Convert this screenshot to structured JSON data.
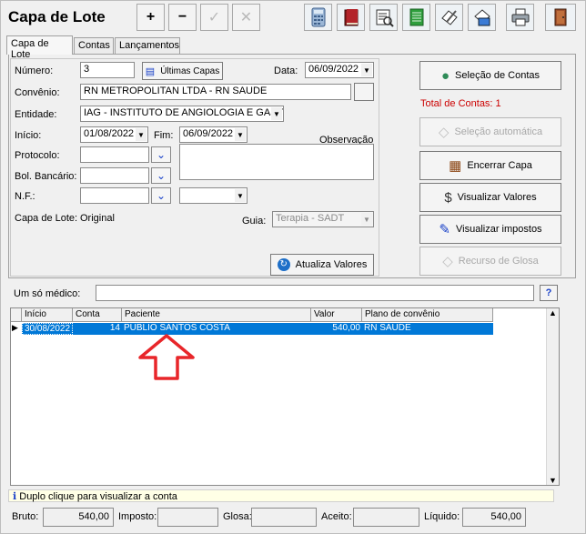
{
  "window": {
    "title": "Capa de Lote"
  },
  "toolbar": {
    "add_label": "+",
    "remove_label": "−",
    "confirm_label": "✓",
    "cancel_label": "✕",
    "icons": [
      "calculator-icon",
      "book-icon",
      "print-preview-icon",
      "spreadsheet-icon",
      "document-edit-icon",
      "money-card-icon",
      "printer-icon",
      "exit-door-icon"
    ]
  },
  "tabs": [
    "Capa de Lote",
    "Contas",
    "Lançamentos"
  ],
  "form": {
    "numero_label": "Número:",
    "numero_value": "3",
    "ultimas_capas_label": "Últimas Capas",
    "data_label": "Data:",
    "data_value": "06/09/2022",
    "convenio_label": "Convênio:",
    "convenio_value": "RN METROPOLITAN LTDA - RN SAUDE",
    "entidade_label": "Entidade:",
    "entidade_value": "IAG - INSTITUTO DE ANGIOLOGIA E GASTI",
    "inicio_label": "Início:",
    "inicio_value": "01/08/2022",
    "fim_label": "Fim:",
    "fim_value": "06/09/2022",
    "observacao_label": "Observação",
    "protocolo_label": "Protocolo:",
    "bol_bancario_label": "Bol. Bancário:",
    "nf_label": "N.F.:",
    "capa_de_lote_label": "Capa de Lote:",
    "capa_de_lote_value": "Original",
    "guia_label": "Guia:",
    "guia_value": "Terapia - SADT",
    "atualiza_valores_label": "Atualiza Valores"
  },
  "right_panel": {
    "selecao_contas": "Seleção de Contas",
    "total_contas": "Total de Contas:  1",
    "selecao_automatica": "Seleção automática",
    "encerrar_capa": "Encerrar Capa",
    "visualizar_valores": "Visualizar Valores",
    "visualizar_impostos": "Visualizar impostos",
    "recurso_glosa": "Recurso de Glosa"
  },
  "medico": {
    "label": "Um só médico:",
    "help": "?"
  },
  "grid": {
    "columns": [
      "Início",
      "Conta",
      "Paciente",
      "Valor",
      "Plano de convênio"
    ],
    "rows": [
      {
        "inicio": "30/08/2022",
        "conta": "14",
        "paciente": "PUBLIO SANTOS COSTA",
        "valor": "540,00",
        "plano": "RN SAUDE"
      }
    ]
  },
  "status_text": "Duplo clique para visualizar a conta",
  "footer": {
    "bruto_label": "Bruto:",
    "bruto_value": "540,00",
    "imposto_label": "Imposto:",
    "imposto_value": "",
    "glosa_label": "Glosa:",
    "glosa_value": "",
    "aceito_label": "Aceito:",
    "aceito_value": "",
    "liquido_label": "Líquido:",
    "liquido_value": "540,00"
  },
  "colors": {
    "selection": "#0078d7",
    "arrow": "#e8262a",
    "total_red": "#cc0000",
    "link_blue": "#1840c8"
  }
}
